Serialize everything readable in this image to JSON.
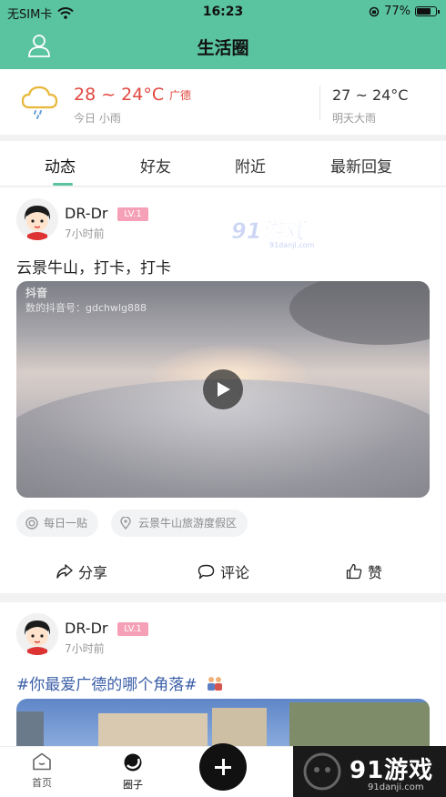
{
  "status_bar": {
    "carrier": "无SIM卡",
    "time": "16:23",
    "battery": "77%",
    "battery_level": 0.77
  },
  "header": {
    "title": "生活圈"
  },
  "weather": {
    "today_temp": "28 ~ 24°C",
    "city": "广德",
    "today_label": "今日 小雨",
    "tomorrow_temp": "27 ~ 24°C",
    "tomorrow_label": "明天大雨"
  },
  "tabs": [
    {
      "label": "动态",
      "active": true
    },
    {
      "label": "好友",
      "active": false
    },
    {
      "label": "附近",
      "active": false
    },
    {
      "label": "最新回复",
      "active": false
    }
  ],
  "watermark": {
    "brand": "91游戏",
    "domain": "91danji.com"
  },
  "posts": [
    {
      "username": "DR-Dr",
      "level": "LV.1",
      "time": "7小时前",
      "text": "云景牛山，打卡，打卡",
      "video_brand": "抖音",
      "video_account": "数的抖音号：gdchwlg888",
      "tags": [
        "每日一贴",
        "云景牛山旅游度假区"
      ],
      "actions": {
        "share": "分享",
        "comment": "评论",
        "like": "赞"
      }
    },
    {
      "username": "DR-Dr",
      "level": "LV.1",
      "time": "7小时前",
      "text": "#你最爱广德的哪个角落#"
    }
  ],
  "bottom_nav": {
    "home": "首页",
    "circle": "圈子"
  },
  "brand_overlay": {
    "name": "91游戏",
    "domain": "91danji.com"
  },
  "colors": {
    "accent": "#5ac3a0",
    "temp_red": "#e0483f",
    "topic_blue": "#3b5ea8",
    "level_pink": "#f5a0b7"
  }
}
